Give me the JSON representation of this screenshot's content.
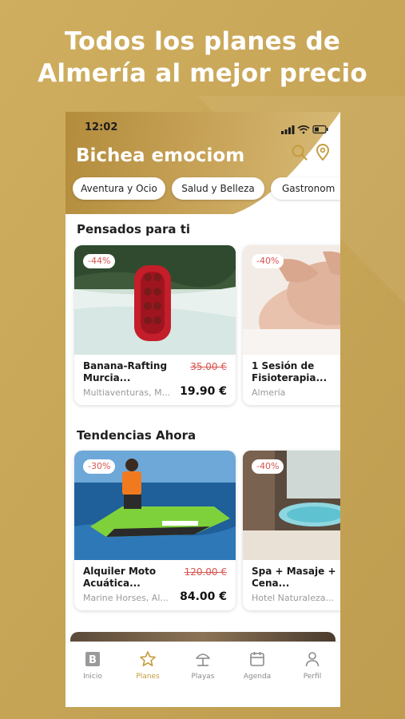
{
  "promo": {
    "line1": "Todos los planes de",
    "line2": "Almería al mejor precio"
  },
  "status_bar": {
    "time": "12:02"
  },
  "header": {
    "title": "Bichea emociom",
    "search_icon": "search-icon",
    "location_icon": "location-pin-icon"
  },
  "categories": [
    "Aventura y Ocio",
    "Salud y Belleza",
    "Gastronom"
  ],
  "sections": [
    {
      "title": "Pensados para ti",
      "cards": [
        {
          "discount": "-44%",
          "title": "Banana-Rafting Murcia...",
          "old_price": "35.00 €",
          "location": "Multiaventuras, M...",
          "price": "19.90 €"
        },
        {
          "discount": "-40%",
          "title": "1 Sesión de Fisioterapia...",
          "old_price": "",
          "location": "Almería",
          "price": ""
        }
      ]
    },
    {
      "title": "Tendencias Ahora",
      "cards": [
        {
          "discount": "-30%",
          "title": "Alquiler Moto Acuática...",
          "old_price": "120.00 €",
          "location": "Marine Horses, Al...",
          "price": "84.00 €"
        },
        {
          "discount": "-40%",
          "title": "Spa + Masaje + Cena...",
          "old_price": "",
          "location": "Hotel Naturaleza...",
          "price": ""
        }
      ]
    }
  ],
  "bottom_nav": [
    {
      "label": "Inicio",
      "icon": "home-logo-icon",
      "active": false
    },
    {
      "label": "Planes",
      "icon": "star-icon",
      "active": true
    },
    {
      "label": "Playas",
      "icon": "beach-umbrella-icon",
      "active": false
    },
    {
      "label": "Agenda",
      "icon": "calendar-icon",
      "active": false
    },
    {
      "label": "Perfil",
      "icon": "user-icon",
      "active": false
    }
  ],
  "colors": {
    "background_gold": "#c9a95b",
    "accent_gold": "#c59b3d",
    "discount_red": "#d9534f"
  }
}
